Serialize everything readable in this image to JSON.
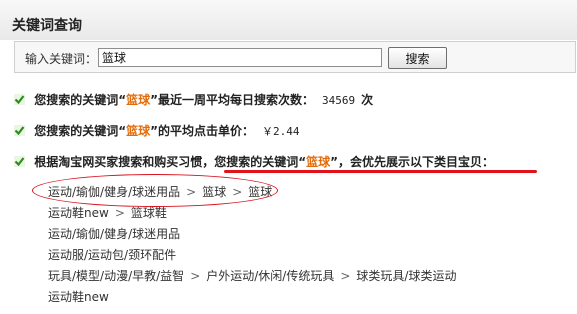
{
  "header": {
    "title": "关键词查询"
  },
  "search": {
    "label": "输入关键词：",
    "value": "篮球",
    "button_label": "搜索"
  },
  "info1": {
    "prefix": "您搜索的关键词“",
    "keyword": "篮球",
    "suffix": "”最近一周平均每日搜索次数：",
    "value": "34569",
    "unit": "次"
  },
  "info2": {
    "prefix": "您搜索的关键词“",
    "keyword": "篮球",
    "suffix": "”的平均点击单价：",
    "value": "￥2.44"
  },
  "info3": {
    "part1": "根据淘宝网买家搜索和购买习惯，",
    "part2": "您搜索的关键词“",
    "keyword": "篮球",
    "part3": "”，会优先展示以下类目宝贝："
  },
  "categories": [
    {
      "parts": [
        "运动/瑜伽/健身/球迷用品",
        "篮球",
        "篮球"
      ]
    },
    {
      "parts": [
        "运动鞋new",
        "篮球鞋"
      ]
    },
    {
      "parts": [
        "运动/瑜伽/健身/球迷用品"
      ]
    },
    {
      "parts": [
        "运动服/运动包/颈环配件"
      ]
    },
    {
      "parts": [
        "玩具/模型/动漫/早教/益智",
        "户外运动/休闲/传统玩具",
        "球类玩具/球类运动"
      ]
    },
    {
      "parts": [
        "运动鞋new"
      ]
    }
  ],
  "separator": ">",
  "colors": {
    "keyword": "#e36c0a",
    "annotation": "#d8121d",
    "icon": "#2e8b20"
  },
  "icons": {
    "bullet": "check-arrow-icon"
  }
}
